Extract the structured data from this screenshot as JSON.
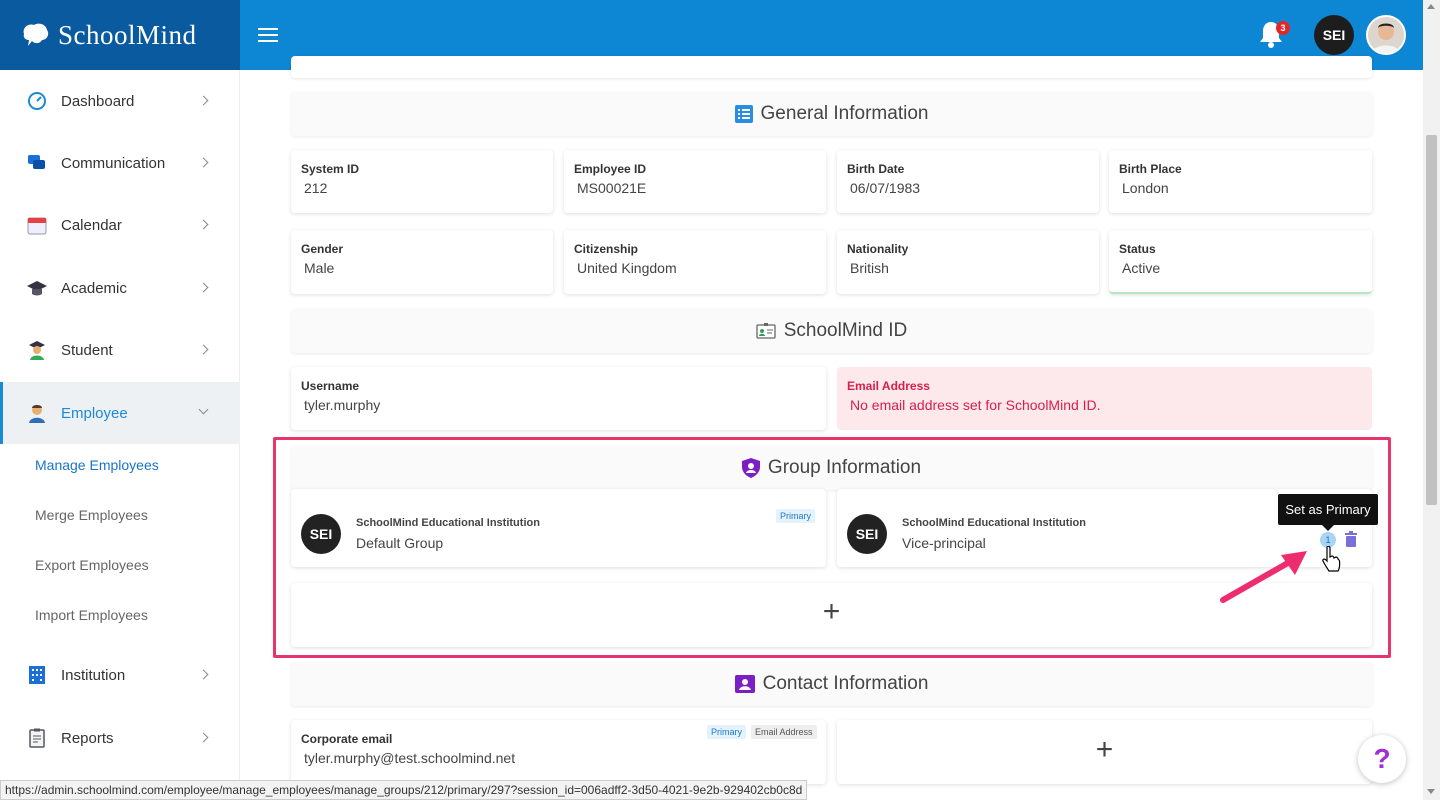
{
  "app": {
    "brand": "SchoolMind"
  },
  "header": {
    "notifications_count": "3",
    "user_initials": "SEI"
  },
  "sidebar": {
    "items": [
      {
        "label": "Dashboard",
        "icon": "speedometer-icon"
      },
      {
        "label": "Communication",
        "icon": "chat-bubbles-icon"
      },
      {
        "label": "Calendar",
        "icon": "calendar-icon"
      },
      {
        "label": "Academic",
        "icon": "graduation-cap-icon"
      },
      {
        "label": "Student",
        "icon": "student-icon"
      },
      {
        "label": "Employee",
        "icon": "employee-icon"
      },
      {
        "label": "Institution",
        "icon": "building-icon"
      },
      {
        "label": "Reports",
        "icon": "clipboard-icon"
      }
    ],
    "employee_sub": [
      "Manage Employees",
      "Merge Employees",
      "Export Employees",
      "Import Employees"
    ]
  },
  "general": {
    "title": "General Information",
    "fields": [
      {
        "key": "System ID",
        "value": "212"
      },
      {
        "key": "Employee ID",
        "value": "MS00021E"
      },
      {
        "key": "Birth Date",
        "value": "06/07/1983"
      },
      {
        "key": "Birth Place",
        "value": "London"
      },
      {
        "key": "Gender",
        "value": "Male"
      },
      {
        "key": "Citizenship",
        "value": "United Kingdom"
      },
      {
        "key": "Nationality",
        "value": "British"
      },
      {
        "key": "Status",
        "value": "Active"
      }
    ]
  },
  "schoolmind_id": {
    "title": "SchoolMind ID",
    "username_label": "Username",
    "username": "tyler.murphy",
    "email_label": "Email Address",
    "email_warning": "No email address set for SchoolMind ID."
  },
  "group": {
    "title": "Group Information",
    "groups": [
      {
        "initials": "SEI",
        "institution": "SchoolMind Educational Institution",
        "name": "Default Group",
        "tag": "Primary"
      },
      {
        "initials": "SEI",
        "institution": "SchoolMind Educational Institution",
        "name": "Vice-principal"
      }
    ],
    "tooltip": "Set as Primary",
    "primary_btn": "1",
    "add": "+"
  },
  "contact": {
    "title": "Contact Information",
    "label": "Corporate email",
    "value": "tyler.murphy@test.schoolmind.net",
    "tags": [
      "Primary",
      "Email Address"
    ],
    "add": "+"
  },
  "help": "?",
  "status_url": "https://admin.schoolmind.com/employee/manage_employees/manage_groups/212/primary/297?session_id=006adff2-3d50-4021-9e2b-929402cb0c8d",
  "colors": {
    "brand_blue": "#0d87d4",
    "sidebar_brand": "#0a5aa0",
    "highlight": "#e8336b",
    "warning": "#d61f4a"
  }
}
